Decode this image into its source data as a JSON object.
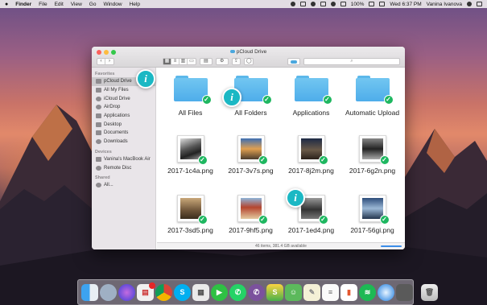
{
  "menubar": {
    "app_name": "Finder",
    "menus": [
      "File",
      "Edit",
      "View",
      "Go",
      "Window",
      "Help"
    ],
    "battery": "100%",
    "clock": "Wed 6:37 PM",
    "user": "Vanina Ivanova"
  },
  "window": {
    "title": "pCloud Drive",
    "toolbar": {
      "back": "‹",
      "forward": "›",
      "gear": "⚙"
    },
    "search_placeholder": "",
    "status": "46 items, 381.4 GB available"
  },
  "sidebar": {
    "sections": [
      {
        "heading": "Favorites",
        "items": [
          "pCloud Drive",
          "All My Files",
          "iCloud Drive",
          "AirDrop",
          "Applications",
          "Desktop",
          "Documents",
          "Downloads"
        ]
      },
      {
        "heading": "Devices",
        "items": [
          "Vanina's MacBook Air",
          "Remote Disc"
        ]
      },
      {
        "heading": "Shared",
        "items": [
          "All..."
        ]
      }
    ],
    "selected": "pCloud Drive"
  },
  "files": [
    {
      "name": "All Files",
      "kind": "folder"
    },
    {
      "name": "All Folders",
      "kind": "folder"
    },
    {
      "name": "Applications",
      "kind": "folder"
    },
    {
      "name": "Automatic Upload",
      "kind": "folder"
    },
    {
      "name": "2017-1c4a.png",
      "kind": "image"
    },
    {
      "name": "2017-3v7s.png",
      "kind": "image"
    },
    {
      "name": "2017-8j2m.png",
      "kind": "image"
    },
    {
      "name": "2017-6g2n.png",
      "kind": "image"
    },
    {
      "name": "2017-3sd5.png",
      "kind": "image"
    },
    {
      "name": "2017-9hf5.png",
      "kind": "image"
    },
    {
      "name": "2017-1ed4.png",
      "kind": "image"
    },
    {
      "name": "2017-56gi.png",
      "kind": "image"
    }
  ],
  "info_marker": "i",
  "check_glyph": "✓",
  "dock_badge": "48",
  "colors": {
    "accent_check": "#1eb760",
    "info_marker": "#1bb8c4",
    "folder": "#5cb8ea"
  }
}
